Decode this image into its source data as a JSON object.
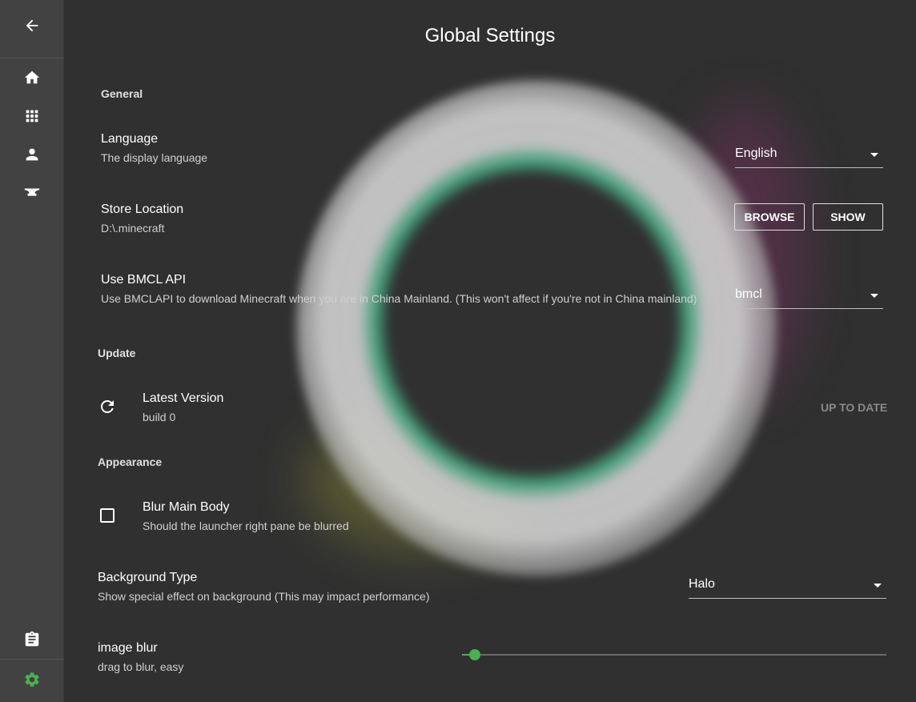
{
  "window": {
    "title": "Global Settings"
  },
  "colors": {
    "accent": "#4caf50",
    "background": "#303030",
    "sidebar": "#424242"
  },
  "sidebar": {
    "items": [
      {
        "icon": "arrow-back-icon"
      },
      {
        "icon": "home-icon"
      },
      {
        "icon": "apps-grid-icon"
      },
      {
        "icon": "person-icon"
      },
      {
        "icon": "anvil-icon"
      },
      {
        "icon": "clipboard-icon"
      },
      {
        "icon": "gear-icon"
      }
    ]
  },
  "sections": {
    "general": "General",
    "update": "Update",
    "appearance": "Appearance"
  },
  "language": {
    "label": "Language",
    "description": "The display language",
    "value": "English"
  },
  "store": {
    "label": "Store Location",
    "path": "D:\\.minecraft",
    "browse": "BROWSE",
    "show": "SHOW"
  },
  "bmcl": {
    "label": "Use BMCL API",
    "description": "Use BMCLAPI to download Minecraft when you are in China Mainland. (This won't affect if you're not in China mainland)",
    "value": "bmcl"
  },
  "update": {
    "label": "Latest Version",
    "build": "build 0",
    "status": "UP TO DATE"
  },
  "blur": {
    "label": "Blur Main Body",
    "description": "Should the launcher right pane be blurred",
    "checked": false
  },
  "background": {
    "label": "Background Type",
    "description": "Show special effect on background (This may impact performance)",
    "value": "Halo"
  },
  "image_blur": {
    "label": "image blur",
    "description": "drag to blur, easy",
    "level": 0.03
  }
}
